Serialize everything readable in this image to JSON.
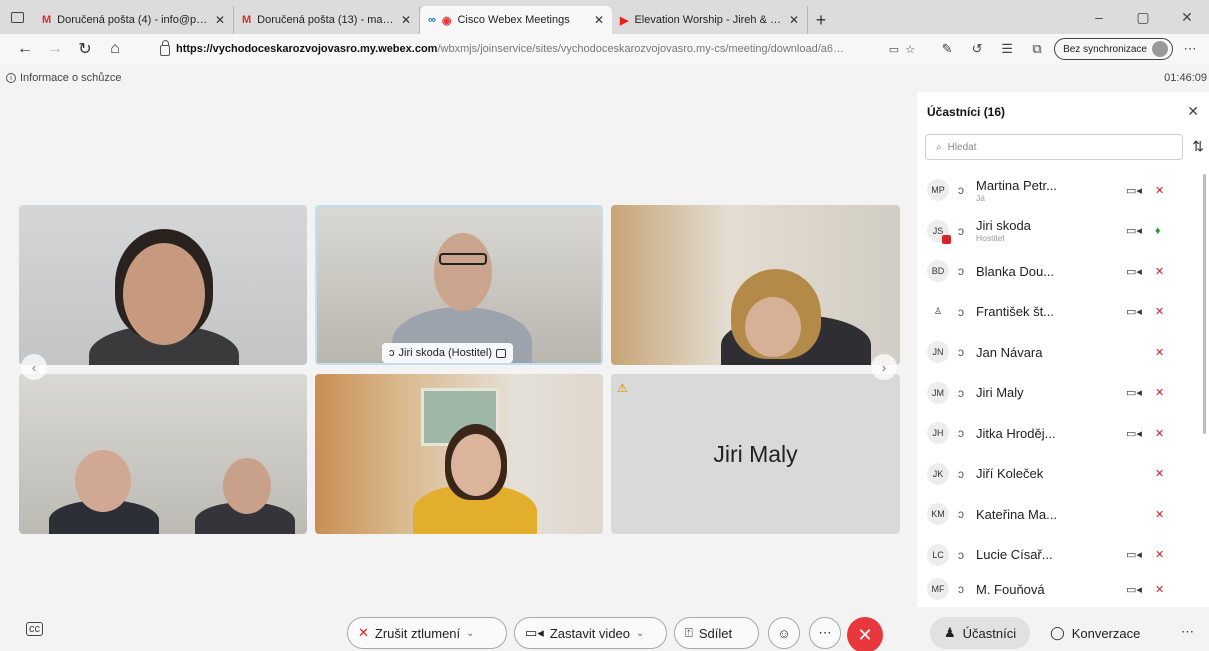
{
  "browser": {
    "tabs": [
      {
        "icon": "M",
        "title": "Doručená pošta (4) - info@priro…",
        "active": false
      },
      {
        "icon": "M",
        "title": "Doručená pošta (13) - martina.p…",
        "active": false
      },
      {
        "icon": "cisco",
        "title": "Cisco Webex Meetings",
        "active": true
      },
      {
        "icon": "yt",
        "title": "Elevation Worship - Jireh & Wor…",
        "active": false
      }
    ],
    "url_host": "https://vychodoceskarozvojovasro.my.webex.com",
    "url_path": "/wbxmjs/joinservice/sites/vychodoceskarozvojovasro.my-cs/meeting/download/a6…",
    "sync_label": "Bez synchronizace",
    "accent": "#1170cf"
  },
  "meeting": {
    "info_label": "Informace o schůzce",
    "time": "01:46:09",
    "host_label": "Jiri skoda (Hostitel)",
    "audio_only_name": "Jiri Maly"
  },
  "panel": {
    "title": "Účastníci (16)",
    "search_placeholder": "Hledat",
    "participants": [
      {
        "initials": "MP",
        "name": "Martina Petr...",
        "role": "Já",
        "camera": true,
        "mic": "muted"
      },
      {
        "initials": "JS",
        "name": "Jiri skoda",
        "role": "Hostitel",
        "camera": true,
        "mic": "on"
      },
      {
        "initials": "BD",
        "name": "Blanka Dou...",
        "role": "",
        "camera": true,
        "mic": "muted"
      },
      {
        "initials": "",
        "name": "František št...",
        "role": "",
        "camera": true,
        "mic": "muted"
      },
      {
        "initials": "JN",
        "name": "Jan Návara",
        "role": "",
        "camera": false,
        "mic": "muted"
      },
      {
        "initials": "JM",
        "name": "Jiri Maly",
        "role": "",
        "camera": true,
        "mic": "muted"
      },
      {
        "initials": "JH",
        "name": "Jitka Hroděj...",
        "role": "",
        "camera": true,
        "mic": "muted"
      },
      {
        "initials": "JK",
        "name": "Jiří Koleček",
        "role": "",
        "camera": false,
        "mic": "muted"
      },
      {
        "initials": "KM",
        "name": "Kateřina Ma...",
        "role": "",
        "camera": false,
        "mic": "muted"
      },
      {
        "initials": "LC",
        "name": "Lucie Císař...",
        "role": "",
        "camera": true,
        "mic": "muted"
      },
      {
        "initials": "MF",
        "name": "M. Fouňová",
        "role": "",
        "camera": true,
        "mic": "muted"
      }
    ]
  },
  "toolbar": {
    "unmute_label": "Zrušit ztlumení",
    "stop_video_label": "Zastavit video",
    "share_label": "Sdílet",
    "participants_tab": "Účastníci",
    "chat_tab": "Konverzace"
  }
}
